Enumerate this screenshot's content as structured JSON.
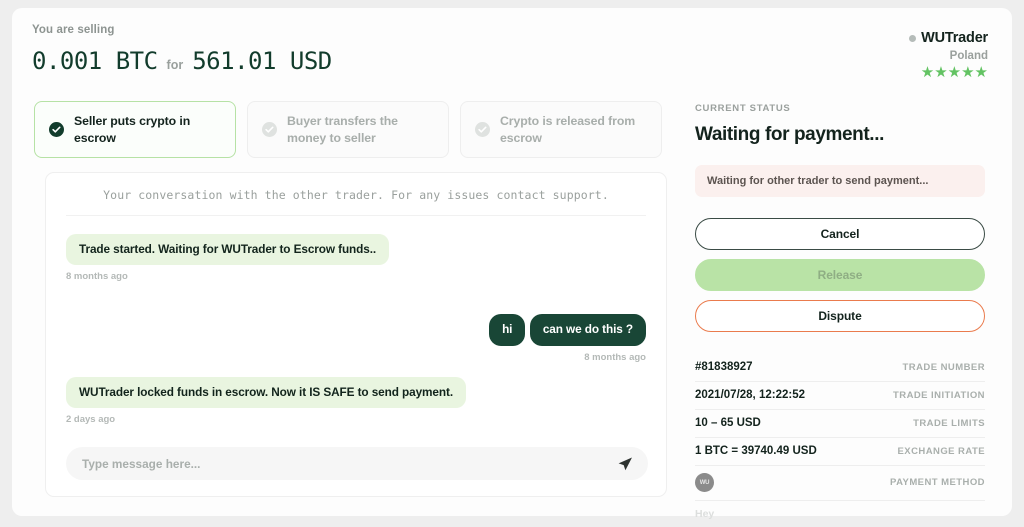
{
  "header": {
    "selling_label": "You are selling",
    "crypto_amount": "0.001 BTC",
    "for_label": "for",
    "fiat_amount": "561.01 USD"
  },
  "trader": {
    "name": "WUTrader",
    "country": "Poland",
    "stars": "★★★★★",
    "star_color": "#63c363",
    "online_status": "offline"
  },
  "steps": [
    {
      "label": "Seller puts crypto in escrow",
      "state": "active",
      "icon": "check-circle-icon"
    },
    {
      "label": "Buyer transfers the money to seller",
      "state": "inactive",
      "icon": "check-circle-icon"
    },
    {
      "label": "Crypto is released from escrow",
      "state": "inactive",
      "icon": "check-circle-icon"
    }
  ],
  "chat": {
    "note": "Your conversation with the other trader. For any issues contact support.",
    "messages": [
      {
        "direction": "in",
        "texts": [
          "Trade started. Waiting for WUTrader to Escrow funds.."
        ],
        "time": "8 months ago"
      },
      {
        "direction": "out",
        "texts": [
          "hi",
          "can we do this ?"
        ],
        "time": "8 months ago"
      },
      {
        "direction": "in",
        "texts": [
          "WUTrader locked funds in escrow. Now it IS SAFE to send payment."
        ],
        "time": "2 days ago"
      }
    ],
    "composer": {
      "placeholder": "Type message here...",
      "value": "",
      "send_icon": "send-paper-plane-icon"
    }
  },
  "status": {
    "kicker": "CURRENT STATUS",
    "title": "Waiting for payment...",
    "alert": "Waiting for other trader to send payment..."
  },
  "actions": {
    "cancel": "Cancel",
    "release": "Release",
    "dispute": "Dispute"
  },
  "details": [
    {
      "value": "#81838927",
      "key": "TRADE NUMBER"
    },
    {
      "value": "2021/07/28, 12:22:52",
      "key": "TRADE INITIATION"
    },
    {
      "value": "10 – 65 USD",
      "key": "TRADE LIMITS"
    },
    {
      "value": "1 BTC = 39740.49 USD",
      "key": "EXCHANGE RATE"
    }
  ],
  "payment_method": {
    "logo_text": "WU",
    "key": "PAYMENT METHOD",
    "note": "Hey"
  }
}
